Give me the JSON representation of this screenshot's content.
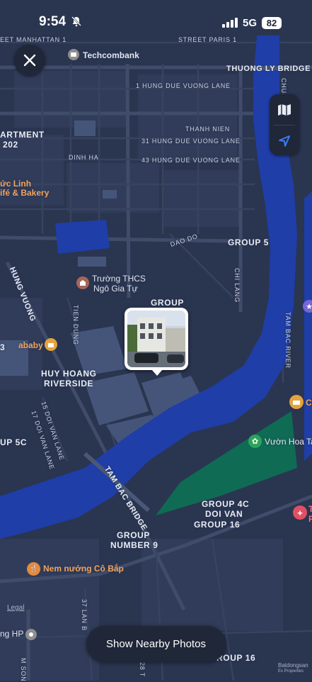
{
  "status_bar": {
    "time": "9:54",
    "network": "5G",
    "battery": "82"
  },
  "controls": {
    "map_icon": "map-icon",
    "location_icon": "location-arrow-icon",
    "close_icon": "close-icon"
  },
  "map": {
    "streets": {
      "manhattan": "EET MANHATTAN 1",
      "street_paris": "STREET PARIS 1",
      "thuong_ly": "THUONG LY BRIDGE",
      "hung_due_1": "1 HUNG DUE VUONG LANE",
      "thanh_nien": "THANH NIEN",
      "hung_due_31": "31 HUNG DUE VUONG LANE",
      "dinh_ha": "DINH HA",
      "hung_due_43": "43 HUNG DUE VUONG LANE",
      "dao_do": "DAO DO",
      "hung_vuong": "HUNG VUONG",
      "tien_dung": "TIEN DUNG",
      "chi_lang": "CHI LANG",
      "tam_bac": "TAM BAC RIVER",
      "doi_van_15": "15 DOI VAN LANE",
      "doi_van_17": "17 DOI VAN LANE",
      "tam_bac_bridge": "TAM BAC BRIDGE",
      "lan_37": "37 LAN B",
      "son": "M SON",
      "r28": "28 T",
      "chu": "CHU"
    },
    "areas": {
      "apartment": "ARTMENT",
      "apt_num": "202",
      "group5": "GROUP 5",
      "group": "GROUP",
      "huy_hoang_1": "HUY HOANG",
      "huy_hoang_2": "RIVERSIDE",
      "up5c": "UP 5C",
      "group4c_1": "GROUP 4C",
      "group4c_2": "DOI VAN",
      "group4c_3": "GROUP 16",
      "number9_1": "GROUP",
      "number9_2": "NUMBER 9",
      "bottom_group": "ROUP 16",
      "left_3": "3"
    },
    "pois": {
      "techcombank": "Techcombank",
      "cafe_1": "ức Linh",
      "cafe_2": "ifé & Bakery",
      "school_1": "Trường THCS",
      "school_2": "Ngô Gia Tự",
      "ababy": "ababy",
      "park": "Vườn Hoa Ta",
      "nem": "Nem nướng Cô Bắp",
      "ng_hp": "ng HP",
      "ch": "Ch",
      "t_top": "T",
      "t_bottom": "P"
    }
  },
  "bottom": {
    "nearby_label": "Show Nearby Photos",
    "legal": "Legal"
  },
  "watermark": {
    "line1": "Batdongsan",
    "line2": "Ex Properties"
  },
  "colors": {
    "land": "#2a3550",
    "road": "#3e4b68",
    "river": "#1f3ea8",
    "park": "#0f6b54",
    "poi_orange": "#e59650"
  }
}
